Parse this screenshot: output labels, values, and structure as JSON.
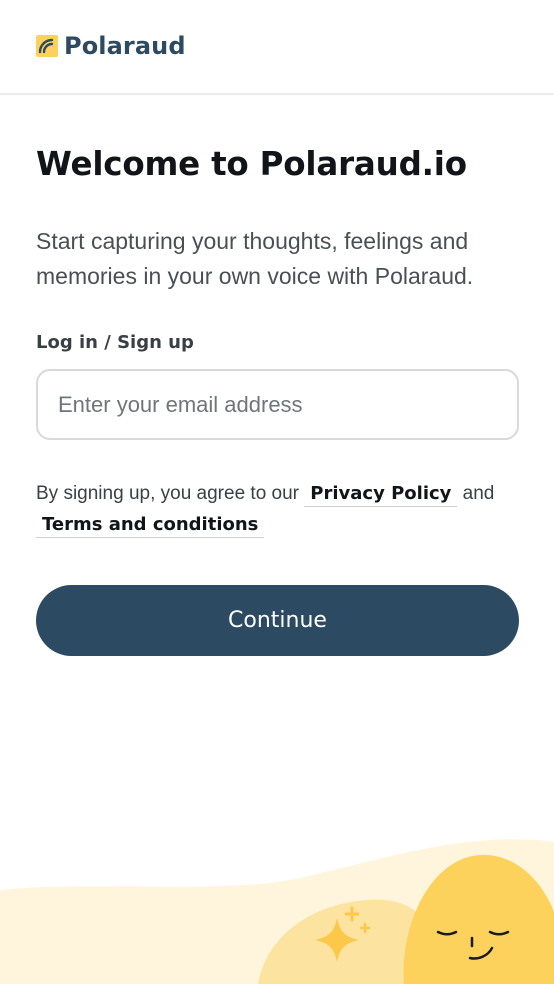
{
  "brand": {
    "name": "Polaraud",
    "color": "#2c4a61",
    "accent": "#fcd15c"
  },
  "main": {
    "title": "Welcome to Polaraud.io",
    "intro": "Start capturing your thoughts, feelings and memories in your own voice with Polaraud.",
    "form": {
      "label": "Log in / Sign up",
      "email_placeholder": "Enter your email address",
      "email_value": ""
    },
    "legal": {
      "prefix": "By signing up, you agree to our ",
      "privacy_link": "Privacy Policy",
      "middle": " and",
      "terms_link": "Terms and conditions"
    },
    "continue_label": "Continue"
  },
  "illustration": {
    "icons": [
      "sparkle-icon",
      "sleeping-face-icon"
    ]
  }
}
